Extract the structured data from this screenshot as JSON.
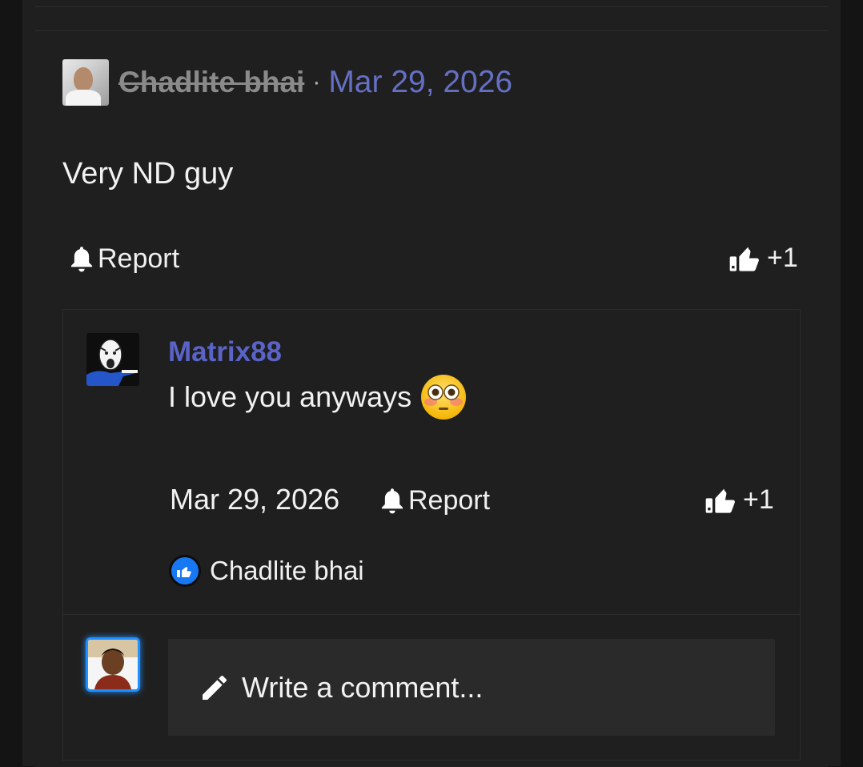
{
  "post": {
    "author": "Chadlite bhai",
    "separator": "·",
    "date": "Mar 29, 2026",
    "body": "Very ND guy",
    "report_label": "Report",
    "like_count": "+1",
    "avatar_icon": "user-photo-avatar"
  },
  "reply": {
    "author": "Matrix88",
    "body": "I love you anyways",
    "emoji": "flushed-face-emoji",
    "date": "Mar 29, 2026",
    "report_label": "Report",
    "like_count": "+1",
    "liked_by": "Chadlite bhai"
  },
  "composer": {
    "placeholder": "Write a comment..."
  },
  "colors": {
    "background": "#1f1f1f",
    "page_edge": "#141414",
    "date_link": "#6570c4",
    "username_link": "#5a64c8",
    "deleted_author": "#8a8a8a",
    "input_bg": "#2a2a2a",
    "self_avatar_border": "#1e90ff",
    "like_badge": "#1877f2"
  }
}
